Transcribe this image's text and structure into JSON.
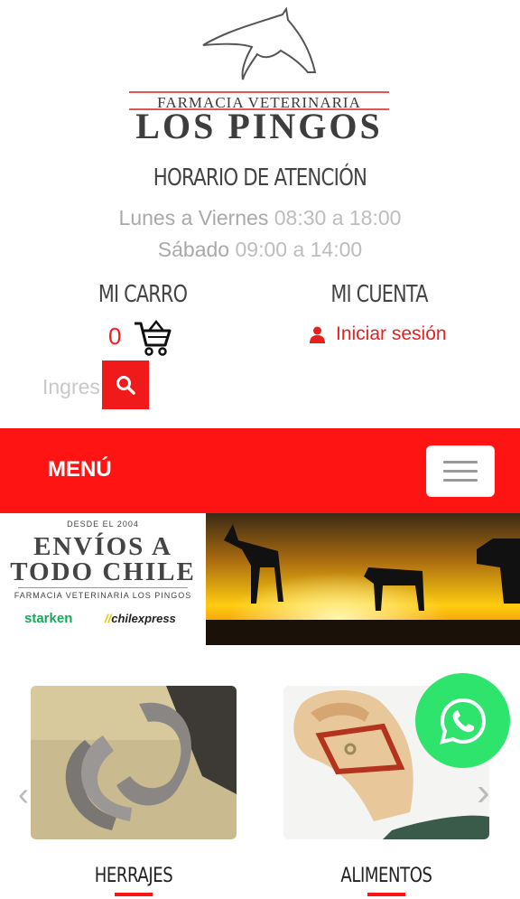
{
  "logo": {
    "subtitle": "FARMACIA VETERINARIA",
    "name": "LOS PINGOS"
  },
  "hours": {
    "title": "HORARIO DE ATENCIÓN",
    "weekdays": "Lunes a Viernes",
    "weekdays_time": "08:30 a 18:00",
    "saturday": "Sábado",
    "saturday_time": "09:00 a 14:00"
  },
  "cart": {
    "title": "MI CARRO",
    "count": "0",
    "icon": "shopping-cart-icon"
  },
  "account": {
    "title": "MI CUENTA",
    "login_label": "Iniciar sesión",
    "icon": "user-icon"
  },
  "search": {
    "placeholder": "Ingrese",
    "icon": "search-icon"
  },
  "nav": {
    "menu_label": "MENÚ",
    "toggler_icon": "hamburger-icon",
    "color": "#ff1414"
  },
  "banner": {
    "since": "DESDE EL 2004",
    "line1": "ENVÍOS A",
    "line2": "TODO CHILE",
    "footer": "FARMACIA VETERINARIA LOS PINGOS",
    "carrier1": "starken",
    "carrier2": "chilexpress"
  },
  "categories": [
    {
      "label": "HERRAJES"
    },
    {
      "label": "ALIMENTOS"
    }
  ],
  "whatsapp": {
    "icon": "whatsapp-icon",
    "color": "#2ee46d"
  },
  "carousel": {
    "prev_icon": "chevron-left-icon",
    "next_icon": "chevron-right-icon"
  }
}
